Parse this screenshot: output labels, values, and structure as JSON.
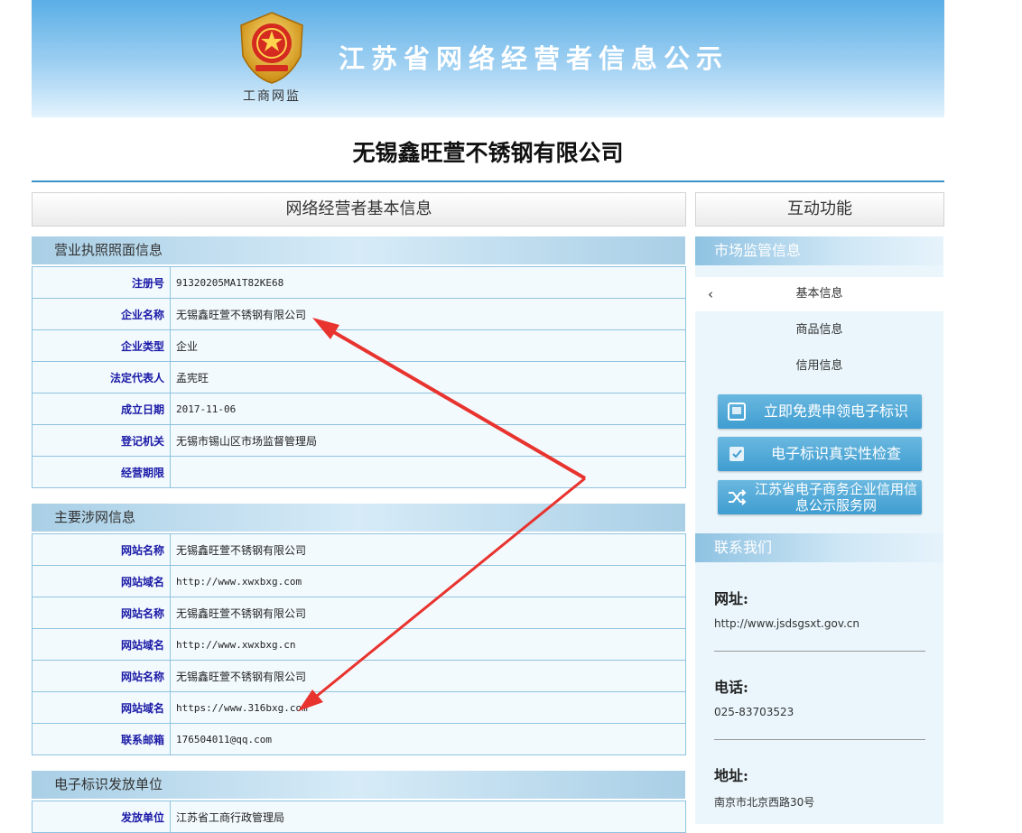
{
  "banner": {
    "title": "江苏省网络经营者信息公示",
    "emblem_caption": "工商网监",
    "emblem_icon": "gov-emblem-icon"
  },
  "company_title": "无锡鑫旺萱不锈钢有限公司",
  "tabs": {
    "basic_info": "网络经营者基本信息",
    "interactive": "互动功能"
  },
  "license_section": {
    "title": "营业执照照面信息",
    "rows": [
      {
        "label": "注册号",
        "value": "91320205MA1T82KE68"
      },
      {
        "label": "企业名称",
        "value": "无锡鑫旺萱不锈钢有限公司"
      },
      {
        "label": "企业类型",
        "value": "企业"
      },
      {
        "label": "法定代表人",
        "value": "孟宪旺"
      },
      {
        "label": "成立日期",
        "value": "2017-11-06"
      },
      {
        "label": "登记机关",
        "value": "无锡市锡山区市场监督管理局"
      },
      {
        "label": "经营期限",
        "value": ""
      }
    ]
  },
  "web_section": {
    "title": "主要涉网信息",
    "rows": [
      {
        "label": "网站名称",
        "value": "无锡鑫旺萱不锈钢有限公司"
      },
      {
        "label": "网站域名",
        "value": "http://www.xwxbxg.com"
      },
      {
        "label": "网站名称",
        "value": "无锡鑫旺萱不锈钢有限公司"
      },
      {
        "label": "网站域名",
        "value": "http://www.xwxbxg.cn"
      },
      {
        "label": "网站名称",
        "value": "无锡鑫旺萱不锈钢有限公司"
      },
      {
        "label": "网站域名",
        "value": "https://www.316bxg.com"
      },
      {
        "label": "联系邮箱",
        "value": "176504011@qq.com"
      }
    ]
  },
  "issuer_section": {
    "title": "电子标识发放单位",
    "rows": [
      {
        "label": "发放单位",
        "value": "江苏省工商行政管理局"
      }
    ]
  },
  "sidebar": {
    "market_title": "市场监管信息",
    "menu": [
      "基本信息",
      "商品信息",
      "信用信息"
    ],
    "buttons": [
      {
        "label": "立即免费申领电子标识",
        "icon": "certificate-icon"
      },
      {
        "label": "电子标识真实性检查",
        "icon": "verify-icon"
      },
      {
        "label": "江苏省电子商务企业信用信息公示服务网",
        "icon": "shuffle-icon"
      }
    ],
    "contact_title": "联系我们",
    "contact": [
      {
        "label": "网址:",
        "value": "http://www.jsdsgsxt.gov.cn"
      },
      {
        "label": "电话:",
        "value": "025-83703523"
      },
      {
        "label": "地址:",
        "value": "南京市北京西路30号"
      }
    ]
  },
  "colors": {
    "banner_top": "#5aaee6",
    "accent": "#3b92c9",
    "label_blue": "#1a1aa6",
    "arrow_red": "#e8332e"
  }
}
